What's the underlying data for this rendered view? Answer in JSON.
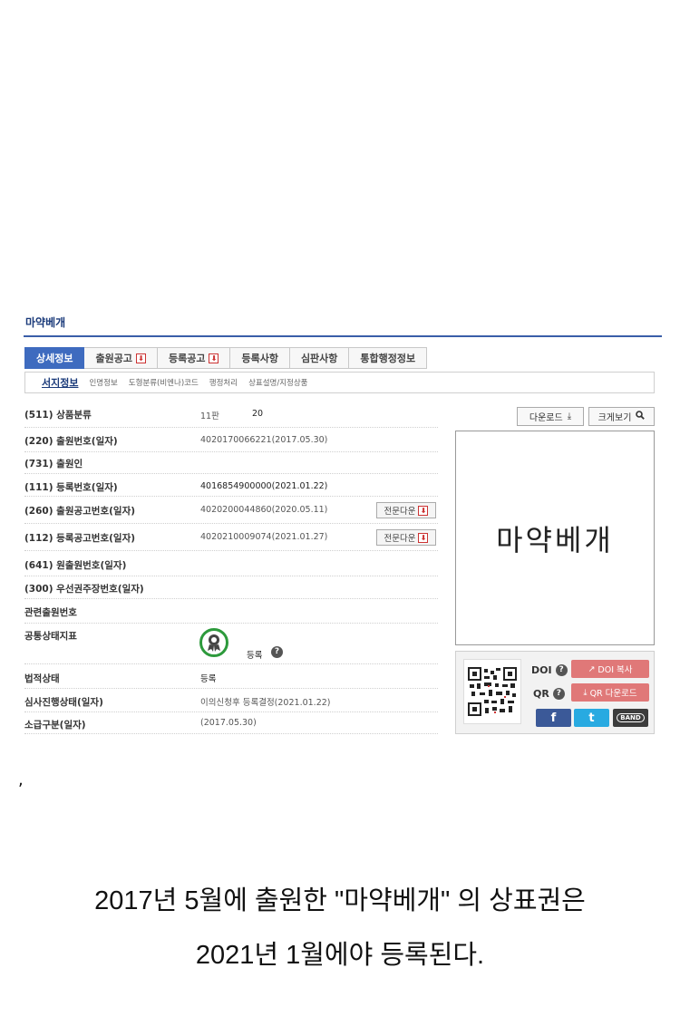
{
  "title": "마약베개",
  "tabs": [
    {
      "label": "상세정보",
      "pdf": false
    },
    {
      "label": "출원공고",
      "pdf": true
    },
    {
      "label": "등록공고",
      "pdf": true
    },
    {
      "label": "등록사항",
      "pdf": false
    },
    {
      "label": "심판사항",
      "pdf": false
    },
    {
      "label": "통합행정정보",
      "pdf": false
    }
  ],
  "subtabs": [
    "서지정보",
    "인명정보",
    "도형분류(비엔나)코드",
    "행정처리",
    "상표설명/지정상품"
  ],
  "rows": {
    "r511": {
      "label": "(511) 상품분류",
      "value_a": "11판",
      "value_b": "20"
    },
    "r220": {
      "label": "(220) 출원번호(일자)",
      "value": "4020170066221(2017.05.30)"
    },
    "r731": {
      "label": "(731) 출원인",
      "value": ""
    },
    "r111": {
      "label": "(111) 등록번호(일자)",
      "value": "4016854900000(2021.01.22)"
    },
    "r260": {
      "label": "(260) 출원공고번호(일자)",
      "value": "4020200044860(2020.05.11)"
    },
    "r112": {
      "label": "(112) 등록공고번호(일자)",
      "value": "4020210009074(2021.01.27)"
    },
    "r641": {
      "label": "(641) 원출원번호(일자)",
      "value": ""
    },
    "r300": {
      "label": "(300) 우선권주장번호(일자)",
      "value": ""
    },
    "related": {
      "label": "관련출원번호",
      "value": ""
    },
    "status_indicator": {
      "label": "공통상태지표",
      "value": "등록"
    },
    "legal": {
      "label": "법적상태",
      "value": "등록"
    },
    "exam": {
      "label": "심사진행상태(일자)",
      "value": "이의신청후 등록결정(2021.01.22)"
    },
    "retro": {
      "label": "소급구분(일자)",
      "value": "(2017.05.30)"
    }
  },
  "full_download_label": "전문다운",
  "download_label": "다운로드",
  "zoom_label": "크게보기",
  "trademark_text": "마약베개",
  "share": {
    "doi_label": "DOI",
    "qr_label": "QR",
    "doi_copy": "DOI 복사",
    "qr_download": "QR 다운로드",
    "facebook": "f",
    "twitter": "t",
    "band": "BAND"
  },
  "comma": ",",
  "caption_line1": "2017년 5월에 출원한 \"마약베개\" 의 상표권은",
  "caption_line2": "2021년 1월에야 등록된다.",
  "colors": {
    "accent": "#3e6bbf",
    "pink": "#e07878",
    "facebook": "#3b5998",
    "twitter": "#28aae1",
    "band": "#3c3c3c"
  }
}
